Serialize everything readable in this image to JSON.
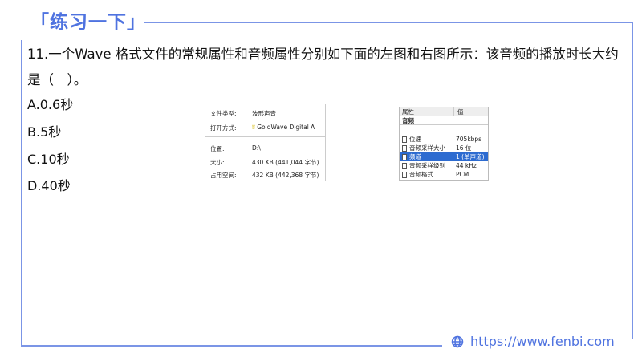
{
  "header": {
    "title": "「练习一下」"
  },
  "question": {
    "text": "11.一个Wave 格式文件的常规属性和音频属性分别如下面的左图和右图所示：该音频的播放时长大约是（　）。"
  },
  "options": [
    "A.0.6秒",
    "B.5秒",
    "C.10秒",
    "D.40秒"
  ],
  "left_figure": {
    "rows": [
      {
        "label": "文件类型:",
        "value": "波形声音"
      },
      {
        "label": "打开方式:",
        "value": "GoldWave Digital A"
      },
      {
        "label": "位置:",
        "value": "D:\\"
      },
      {
        "label": "大小:",
        "value": "430 KB (441,044 字节)"
      },
      {
        "label": "占用空间:",
        "value": "432 KB (442,368 字节)"
      }
    ]
  },
  "right_figure": {
    "col1": "属性",
    "col2": "值",
    "group": "音频",
    "rows": [
      {
        "label": "位速",
        "value": "705kbps"
      },
      {
        "label": "音频采样大小",
        "value": "16 位"
      },
      {
        "label": "频道",
        "value": "1 (单声道)",
        "selected": true
      },
      {
        "label": "音频采样级别",
        "value": "44 kHz"
      },
      {
        "label": "音频格式",
        "value": "PCM"
      }
    ]
  },
  "footer": {
    "url": "https://www.fenbi.com",
    "icon": "globe-icon"
  },
  "colors": {
    "accent": "#4f73e0"
  }
}
